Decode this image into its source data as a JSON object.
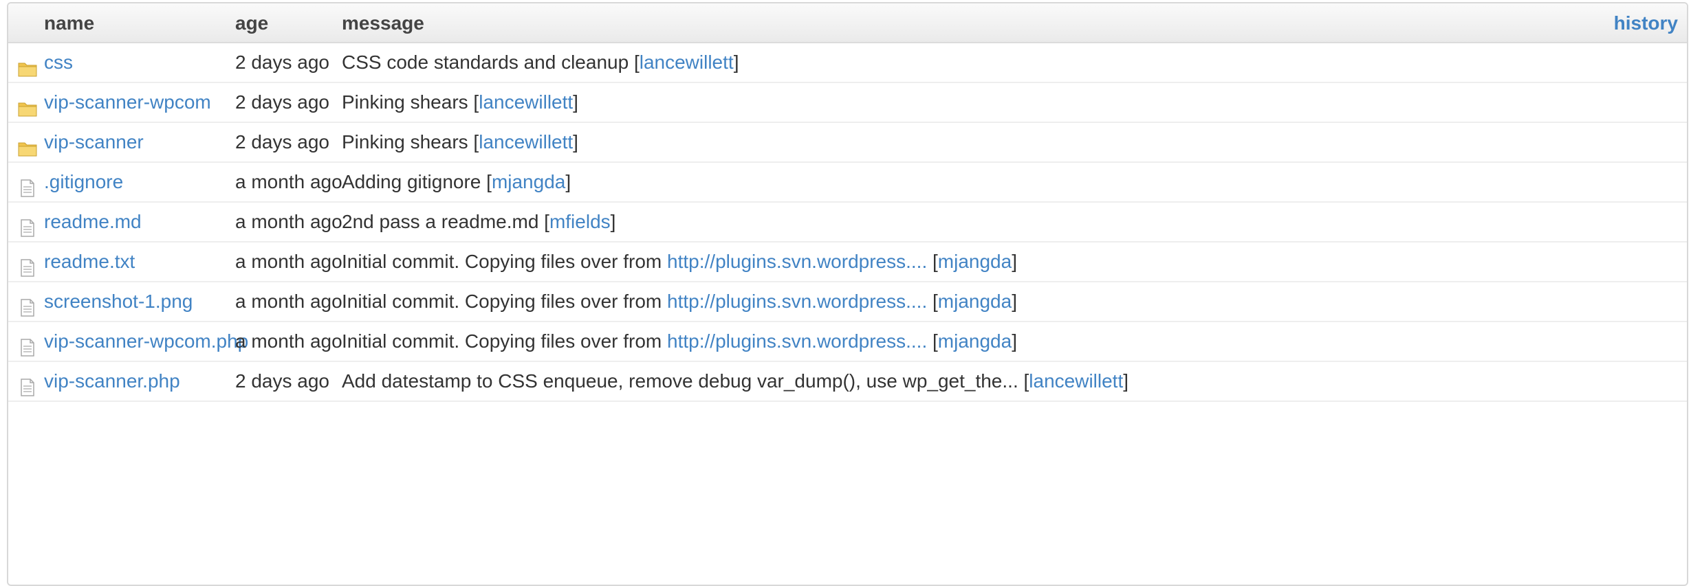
{
  "header": {
    "name_label": "name",
    "age_label": "age",
    "message_label": "message",
    "history_label": "history"
  },
  "colors": {
    "link": "#4183c4",
    "folder": "#f0c44e",
    "text": "#333333"
  },
  "files": [
    {
      "type": "folder",
      "icon": "folder-icon",
      "name": "css",
      "age": "2 days ago",
      "message": "CSS code standards and cleanup [",
      "link": "",
      "author": "lancewillett",
      "suffix": "]"
    },
    {
      "type": "folder",
      "icon": "folder-icon",
      "name": "vip-scanner-wpcom",
      "age": "2 days ago",
      "message": "Pinking shears [",
      "link": "",
      "author": "lancewillett",
      "suffix": "]"
    },
    {
      "type": "folder",
      "icon": "folder-icon",
      "name": "vip-scanner",
      "age": "2 days ago",
      "message": "Pinking shears [",
      "link": "",
      "author": "lancewillett",
      "suffix": "]"
    },
    {
      "type": "file",
      "icon": "file-icon",
      "name": ".gitignore",
      "age": "a month ago",
      "message": "Adding gitignore [",
      "link": "",
      "author": "mjangda",
      "suffix": "]"
    },
    {
      "type": "file",
      "icon": "file-icon",
      "name": "readme.md",
      "age": "a month ago",
      "message": "2nd pass a readme.md [",
      "link": "",
      "author": "mfields",
      "suffix": "]"
    },
    {
      "type": "file",
      "icon": "file-icon",
      "name": "readme.txt",
      "age": "a month ago",
      "message": "Initial commit. Copying files over from ",
      "link": "http://plugins.svn.wordpress....",
      "author": "mjangda",
      "suffix": "]"
    },
    {
      "type": "file",
      "icon": "file-icon",
      "name": "screenshot-1.png",
      "age": "a month ago",
      "message": "Initial commit. Copying files over from ",
      "link": "http://plugins.svn.wordpress....",
      "author": "mjangda",
      "suffix": "]"
    },
    {
      "type": "file",
      "icon": "file-icon",
      "name": "vip-scanner-wpcom.php",
      "age": "a month ago",
      "message": "Initial commit. Copying files over from ",
      "link": "http://plugins.svn.wordpress....",
      "author": "mjangda",
      "suffix": "]"
    },
    {
      "type": "file",
      "icon": "file-icon",
      "name": "vip-scanner.php",
      "age": "2 days ago",
      "message": "Add datestamp to CSS enqueue, remove debug var_dump(), use wp_get_the... [",
      "link": "",
      "author": "lancewillett",
      "suffix": "]"
    }
  ]
}
